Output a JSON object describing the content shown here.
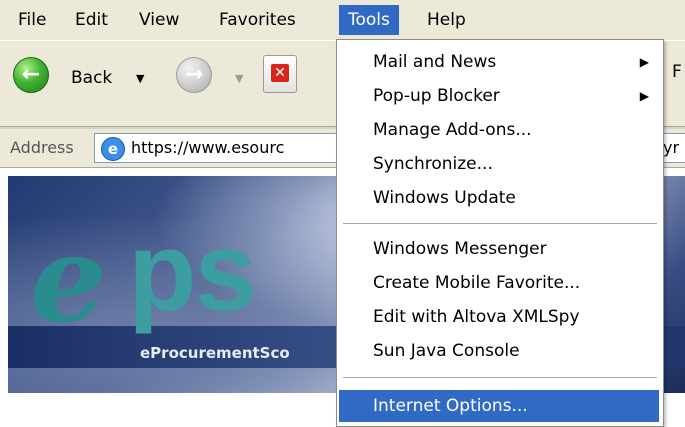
{
  "menubar": {
    "items": [
      {
        "label": "File"
      },
      {
        "label": "Edit"
      },
      {
        "label": "View"
      },
      {
        "label": "Favorites"
      },
      {
        "label": "Tools",
        "active": true
      },
      {
        "label": "Help"
      }
    ]
  },
  "toolbar": {
    "back_label": "Back",
    "right_fragment": "F"
  },
  "address": {
    "label": "Address",
    "url_visible": "https://www.esourc",
    "url_tail_fragment": "yr"
  },
  "banner": {
    "logo_e": "e",
    "logo_ps": "ps",
    "subtitle": "eProcurementSco"
  },
  "tools_menu": {
    "groups": [
      [
        {
          "label": "Mail and News",
          "submenu": true
        },
        {
          "label": "Pop-up Blocker",
          "submenu": true
        },
        {
          "label": "Manage Add-ons..."
        },
        {
          "label": "Synchronize..."
        },
        {
          "label": "Windows Update"
        }
      ],
      [
        {
          "label": "Windows Messenger"
        },
        {
          "label": "Create Mobile Favorite..."
        },
        {
          "label": "Edit with Altova XMLSpy"
        },
        {
          "label": "Sun Java Console"
        }
      ],
      [
        {
          "label": "Internet Options...",
          "highlighted": true
        }
      ]
    ],
    "submenu_glyph": "▶"
  },
  "colors": {
    "highlight": "#316ac5",
    "chrome": "#ece9d8",
    "logo_teal": "#3c9ea0"
  }
}
